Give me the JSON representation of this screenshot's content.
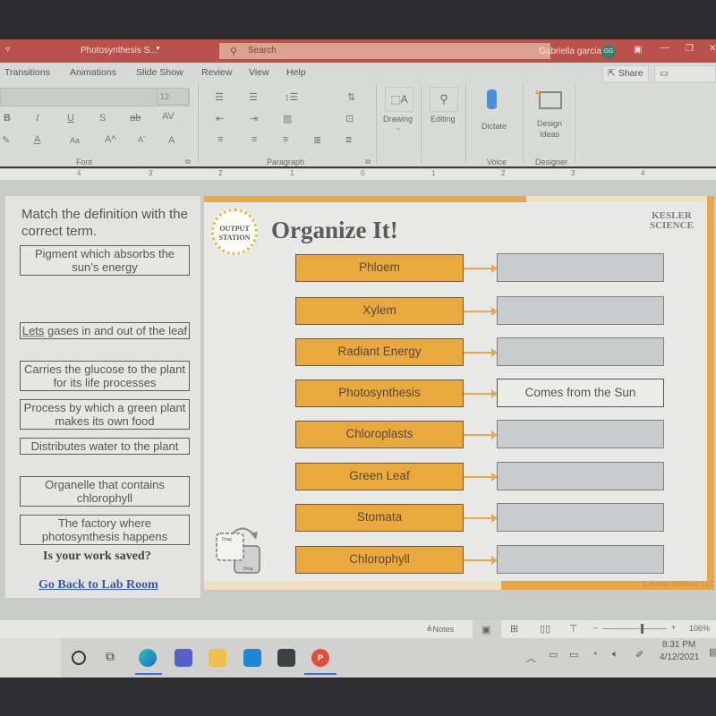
{
  "window": {
    "title": "Photosynthesis S...",
    "title_dropdown_icon": "chevron-down-icon",
    "search_placeholder": "Search",
    "user_name": "Gabriella garcia",
    "user_initials": "GG",
    "window_controls": [
      "ribbon-display-icon",
      "minimize-icon",
      "restore-icon",
      "close-icon"
    ]
  },
  "menu": {
    "tabs": [
      "Transitions",
      "Animations",
      "Slide Show",
      "Review",
      "View",
      "Help"
    ],
    "share_label": "Share",
    "comments_label": "Comments"
  },
  "ribbon": {
    "font_size": "12",
    "font_group_label": "Font",
    "paragraph_group_label": "Paragraph",
    "voice_group_label": "Voice",
    "designer_group_label": "Designer",
    "drawing_label": "Drawing",
    "editing_label": "Editing",
    "dictate_label": "Dictate",
    "design_ideas_label": "Design Ideas",
    "font_buttons": [
      "B",
      "I",
      "U",
      "S",
      "ab",
      "AV",
      "A",
      "Aa",
      "A^",
      "Aˇ",
      "A"
    ],
    "ruler_numbers": [
      "4",
      "3",
      "2",
      "1",
      "0",
      "1",
      "2",
      "3",
      "4"
    ]
  },
  "left_panel": {
    "instruction": "Match the definition with the correct term.",
    "definitions": [
      "Pigment which absorbs the sun’s energy",
      "Lets gases in and out of the leaf",
      "Carries the glucose to the plant for its life processes",
      "Process by which a green plant makes its own food",
      "Distributes water to the plant",
      "Organelle that contains chlorophyll",
      "The factory where photosynthesis happens"
    ],
    "saved_prompt": "Is your work saved?",
    "back_link": "Go Back to Lab Room"
  },
  "slide": {
    "badge_line1": "OUTPUT",
    "badge_line2": "STATION",
    "title": "Organize It!",
    "logo_line1": "KESLER",
    "logo_line2": "SCIENCE",
    "terms": [
      "Phloem",
      "Xylem",
      "Radiant Energy",
      "Photosynthesis",
      "Chloroplasts",
      "Green Leaf",
      "Stomata",
      "Chlorophyll"
    ],
    "answers": [
      "",
      "",
      "",
      "Comes from the Sun",
      "",
      "",
      "",
      ""
    ],
    "drag_label": "Drag",
    "drop_label": "Drop",
    "copyright": "© Kesler Science, LLC",
    "colors": {
      "term_fill": "#eaa93f",
      "answer_empty": "#c9cacb",
      "accent": "#eaa84a"
    }
  },
  "statusbar": {
    "notes_label": "Notes",
    "zoom_level": "106%",
    "zoom_fraction": 0.6
  },
  "taskbar": {
    "apps": [
      "cortana-icon",
      "task-view-icon",
      "edge-icon",
      "teams-icon",
      "file-explorer-icon",
      "mail-icon",
      "store-icon",
      "powerpoint-icon"
    ],
    "time": "8:31 PM",
    "date": "4/12/2021"
  }
}
